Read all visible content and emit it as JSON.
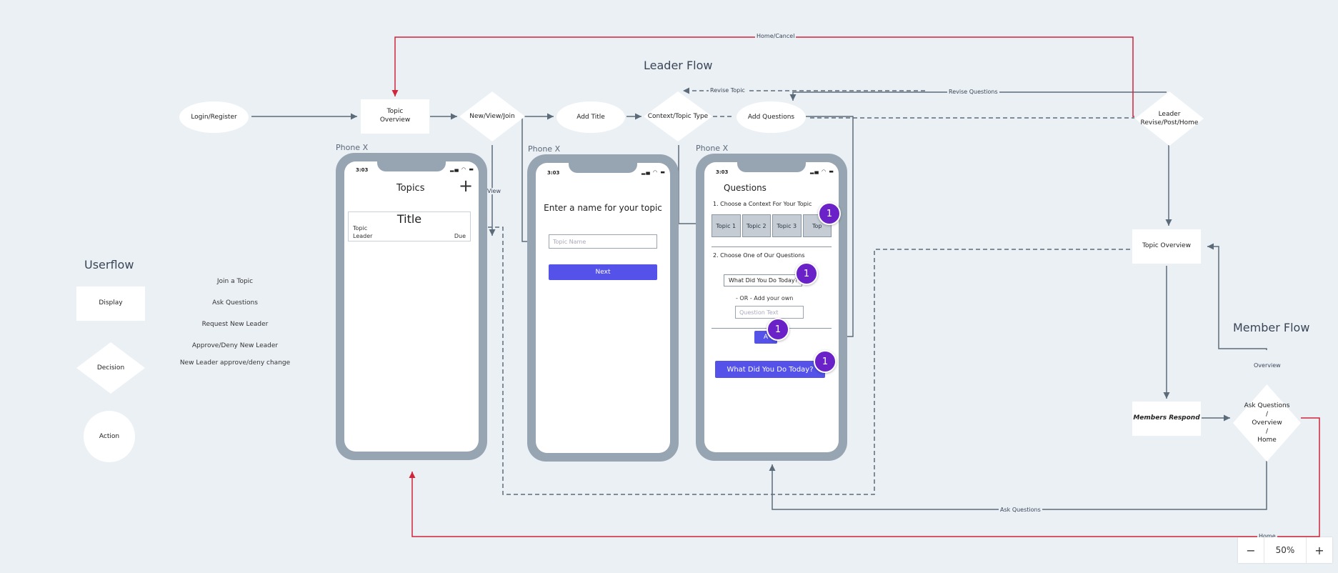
{
  "headings": {
    "leader_flow": "Leader Flow",
    "member_flow": "Member Flow",
    "userflow": "Userflow"
  },
  "legend": {
    "display": "Display",
    "decision": "Decision",
    "action": "Action",
    "items": [
      "Join a Topic",
      "Ask Questions",
      "Request New Leader",
      "Approve/Deny New Leader",
      "New Leader approve/deny change"
    ]
  },
  "nodes": {
    "login": "Login/Register",
    "topic_overview_1": "Topic\nOverview",
    "new_view_join": "New/View/Join",
    "add_title": "Add Title",
    "context_type": "Context/Topic Type",
    "add_questions": "Add Questions",
    "leader_revise": "Leader\nRevise/Post/Home",
    "topic_overview_2": "Topic Overview",
    "members_respond": "Members Respond",
    "member_decision": "Ask Questions\n/\nOverview\n/\nHome"
  },
  "connector_labels": {
    "home_cancel": "Home/Cancel",
    "revise_topic": "Revise Topic",
    "revise_questions": "Revise Questions",
    "view": "View",
    "overview": "Overview",
    "ask_questions": "Ask Questions",
    "home": "Home"
  },
  "phones": {
    "frame_label": "Phone X",
    "time": "3:03",
    "status_icons": "▂▄ ◠ ▬",
    "topics": {
      "title": "Topics",
      "add": "+",
      "card_title": "Title",
      "card_topic": "Topic",
      "card_leader": "Leader",
      "card_due": "Due"
    },
    "name": {
      "prompt": "Enter a name for your topic",
      "placeholder": "Topic Name",
      "next": "Next"
    },
    "questions": {
      "title": "Questions",
      "step1": "1. Choose a Context For Your Topic",
      "tabs": [
        "Topic 1",
        "Topic 2",
        "Topic 3",
        "Top"
      ],
      "step2": "2. Choose One of Our Questions",
      "suggested": "What Did You Do Today?",
      "or_text": "- OR - Add your own",
      "question_placeholder": "Question Text",
      "add_btn": "A",
      "arrow": "↓",
      "result": "What Did You Do Today?"
    }
  },
  "badges": [
    "1",
    "1",
    "1",
    "1"
  ],
  "zoom": {
    "minus": "−",
    "level": "50%",
    "plus": "+"
  },
  "colors": {
    "connector": "#5c6b7a",
    "accent_red": "#d0243b",
    "badge": "#6b21c8",
    "primary": "#5452e8"
  }
}
